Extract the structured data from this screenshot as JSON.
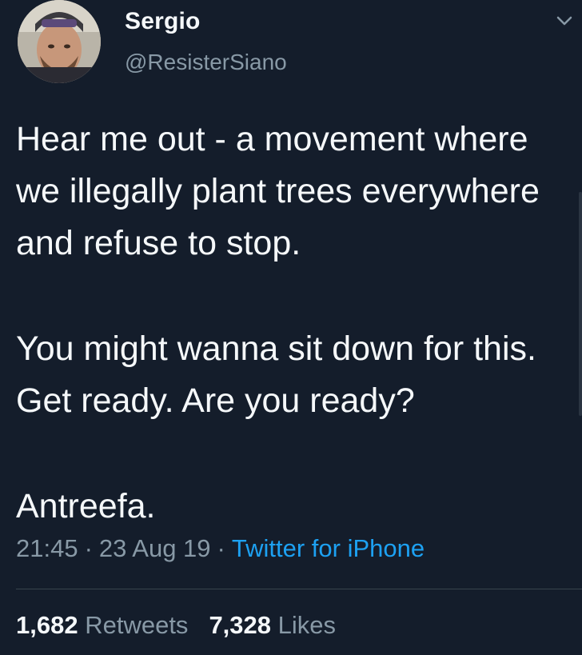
{
  "author": {
    "display_name": "Sergio",
    "handle": "@ResisterSiano"
  },
  "tweet": {
    "paragraphs": [
      "Hear me out - a movement where we illegally plant trees everywhere and refuse to stop.",
      "You might wanna sit down for this. Get ready. Are you ready?",
      "Antreefa."
    ],
    "time": "21:45",
    "date": "23 Aug 19",
    "source": "Twitter for iPhone",
    "separator": "·"
  },
  "stats": {
    "retweets_count": "1,682",
    "retweets_label": "Retweets",
    "likes_count": "7,328",
    "likes_label": "Likes"
  },
  "colors": {
    "background": "#141d2b",
    "text": "#f5f8fa",
    "secondary": "#8899a6",
    "link": "#1da1f2"
  },
  "icons": {
    "menu": "chevron-down-icon"
  }
}
